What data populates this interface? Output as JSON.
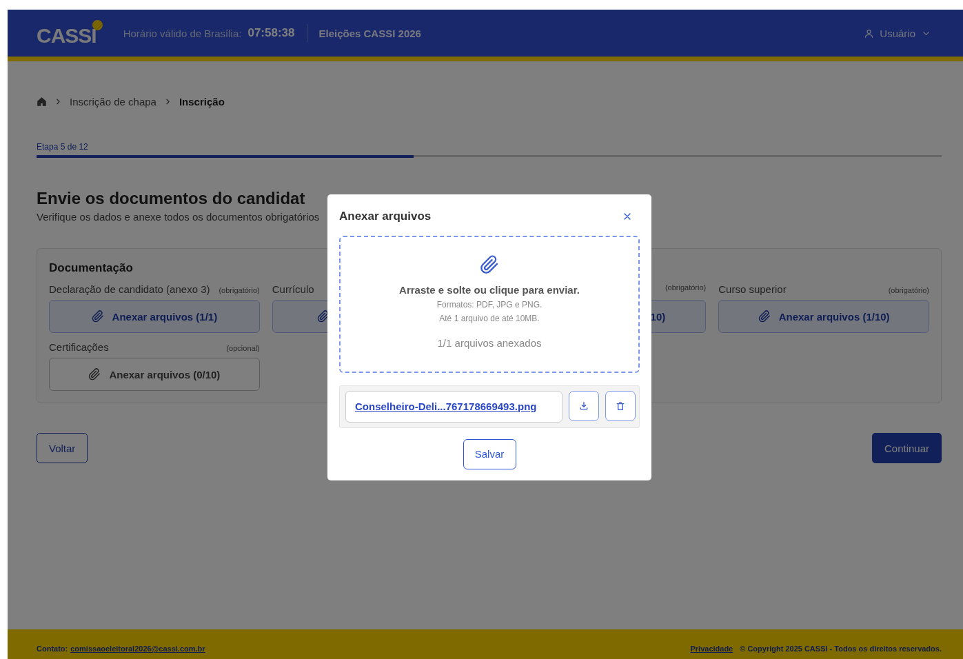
{
  "header": {
    "logo": "CASSI",
    "clock_label": "Horário válido de Brasília:",
    "clock": "07:58:38",
    "election": "Eleições CASSI 2026",
    "user": "Usuário"
  },
  "breadcrumb": [
    {
      "label": "Inscrição de chapa",
      "current": false
    },
    {
      "label": "Inscrição",
      "current": true
    }
  ],
  "step": {
    "label": "Etapa 5 de 12",
    "level": 0.4167
  },
  "title": "Envie os documentos do candidat",
  "subtitle": "Verifique os dados e anexe todos os documentos obrigatórios",
  "documents": {
    "title": "Documentação",
    "fields": [
      {
        "label": "Declaração de candidato (anexo 3)",
        "hint": "(obrigatório)",
        "button": "Anexar arquivos (1/1)",
        "filled": true,
        "kind": "full"
      },
      {
        "label": "Currículo",
        "filled": true,
        "kind": "headpart"
      },
      {
        "hint": "(obrigatório)",
        "button": "10)",
        "filled": true,
        "kind": "tailpart"
      },
      {
        "label": "Curso superior",
        "hint": "(obrigatório)",
        "button": "Anexar arquivos (1/10)",
        "filled": true,
        "kind": "full"
      },
      {
        "label": "Certificações",
        "hint": "(opcional)",
        "button": "Anexar arquivos (0/10)",
        "filled": false,
        "kind": "full"
      }
    ]
  },
  "actions": {
    "back": "Voltar",
    "continue": "Continuar"
  },
  "footer": {
    "contact_label": "Contato:",
    "email": "comissaoeleitoral2026@cassi.com.br",
    "privacy": "Privacidade",
    "copyright": "© Copyright 2025 CASSI - Todos os direitos reservados."
  },
  "modal": {
    "title": "Anexar arquivos",
    "dropzone": {
      "instruction": "Arraste e solte ou clique para enviar.",
      "formats": "Formatos: PDF, JPG e PNG.",
      "limit": "Até 1 arquivo de até 10MB.",
      "count": "1/1 arquivos anexados"
    },
    "files": [
      {
        "name": "Conselheiro-Deli...767178669493.png"
      }
    ],
    "save": "Salvar"
  }
}
